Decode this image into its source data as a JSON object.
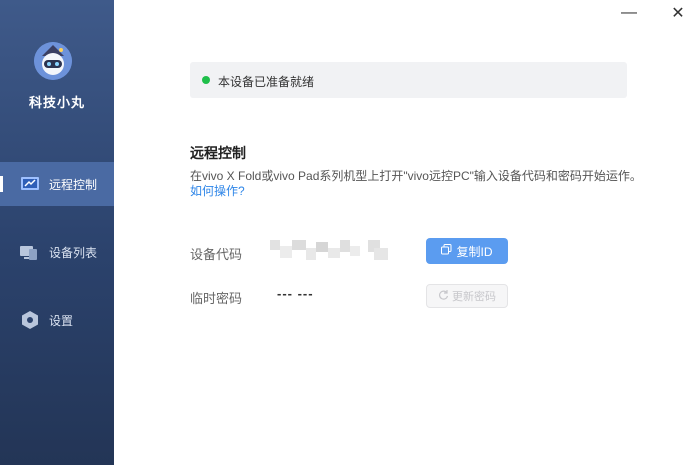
{
  "app": {
    "name": "科技小丸"
  },
  "sidebar": {
    "items": [
      {
        "label": "远程控制",
        "icon": "remote-control-icon",
        "active": true
      },
      {
        "label": "设备列表",
        "icon": "device-list-icon",
        "active": false
      },
      {
        "label": "设置",
        "icon": "settings-icon",
        "active": false
      }
    ]
  },
  "window": {
    "minimize": "—",
    "close": "✕"
  },
  "status": {
    "text": "本设备已准备就绪",
    "color": "#1fbf4a"
  },
  "main": {
    "title": "远程控制",
    "description": "在vivo X Fold或vivo Pad系列机型上打开\"vivo远控PC\"输入设备代码和密码开始运作。",
    "help_link": "如何操作?",
    "device_code": {
      "label": "设备代码"
    },
    "temp_password": {
      "label": "临时密码",
      "value": "--- ---"
    },
    "copy_button": "复制ID",
    "refresh_button": "更新密码"
  },
  "colors": {
    "accent": "#5b9cf0",
    "sidebar": "#2b426c",
    "link": "#2f86e8"
  }
}
